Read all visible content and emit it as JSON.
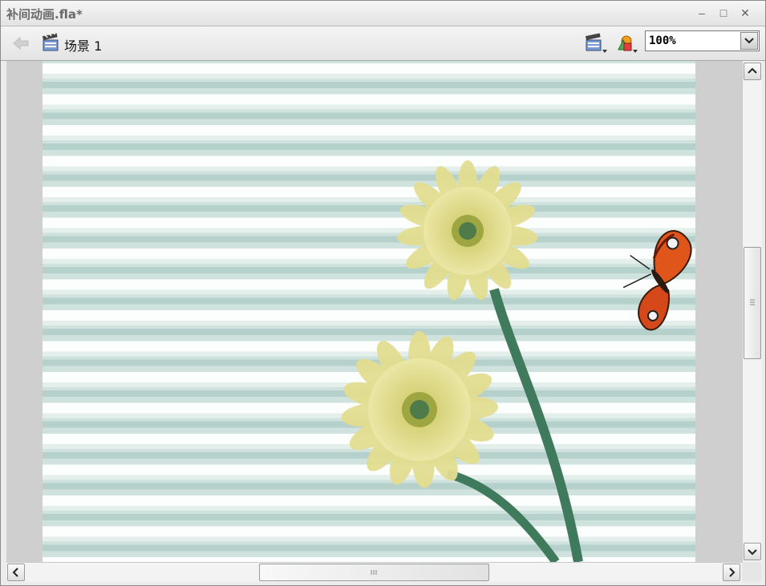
{
  "window": {
    "title": "补间动画.fla*",
    "controls": {
      "minimize": "–",
      "maximize": "□",
      "close": "✕"
    }
  },
  "toolbar": {
    "back_icon": "back-arrow-icon",
    "scene_icon": "clapperboard-icon",
    "scene_label": "场景 1",
    "edit_scene_icon": "edit-scene-icon",
    "edit_symbols_icon": "edit-symbols-icon",
    "zoom_value": "100%"
  },
  "stage": {
    "background": "striped window blinds with two yellow gerbera flowers",
    "object": "butterfly"
  },
  "colors": {
    "stage_base": "#e7f2ef",
    "stripe_light": "#fbfefd",
    "stripe_dark": "#b9d3ce",
    "flower": "#dcd67a",
    "stem": "#3f7a5c",
    "butterfly": "#e0561a"
  }
}
